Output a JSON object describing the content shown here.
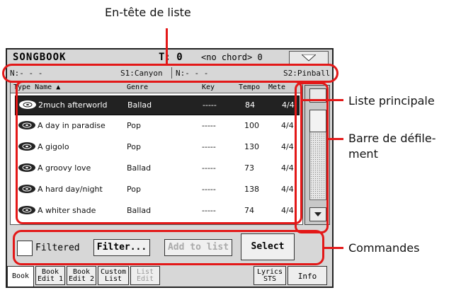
{
  "callouts": {
    "header": "En-tête de liste",
    "main_list": "Liste principale",
    "scrollbar_line1": "Barre de défile-",
    "scrollbar_line2": "ment",
    "commands": "Commandes"
  },
  "titlebar": {
    "app": "SONGBOOK",
    "transpose": "T: 0",
    "chord": "<no chord> 0"
  },
  "info": {
    "n1": "N:- - -",
    "s1": "S1:Canyon",
    "n2": "N:- - -",
    "s2": "S2:Pinball"
  },
  "list": {
    "headers": {
      "type_name": "Type Name",
      "genre": "Genre",
      "key": "Key",
      "tempo": "Tempo",
      "meter": "Mete"
    },
    "rows": [
      {
        "name": "2much afterworld",
        "genre": "Ballad",
        "key": "-----",
        "tempo": "84",
        "meter": "4/4"
      },
      {
        "name": "A day in paradise",
        "genre": "Pop",
        "key": "-----",
        "tempo": "100",
        "meter": "4/4"
      },
      {
        "name": "A gigolo",
        "genre": "Pop",
        "key": "-----",
        "tempo": "130",
        "meter": "4/4"
      },
      {
        "name": "A groovy love",
        "genre": "Ballad",
        "key": "-----",
        "tempo": "73",
        "meter": "4/4"
      },
      {
        "name": "A hard day/night",
        "genre": "Pop",
        "key": "-----",
        "tempo": "138",
        "meter": "4/4"
      },
      {
        "name": "A whiter shade",
        "genre": "Ballad",
        "key": "-----",
        "tempo": "74",
        "meter": "4/4"
      }
    ]
  },
  "commands": {
    "filtered": "Filtered",
    "filter": "Filter...",
    "add_to_list": "Add to list",
    "select": "Select"
  },
  "tabs": {
    "book": "Book",
    "book_edit1_a": "Book",
    "book_edit1_b": "Edit 1",
    "book_edit2_a": "Book",
    "book_edit2_b": "Edit 2",
    "custom_a": "Custom",
    "custom_b": "List",
    "listedit_a": "List",
    "listedit_b": "Edit",
    "lyrics_a": "Lyrics",
    "lyrics_b": "STS",
    "info": "Info"
  },
  "colors": {
    "callout_red": "#e31818",
    "selected_row": "#222222"
  }
}
